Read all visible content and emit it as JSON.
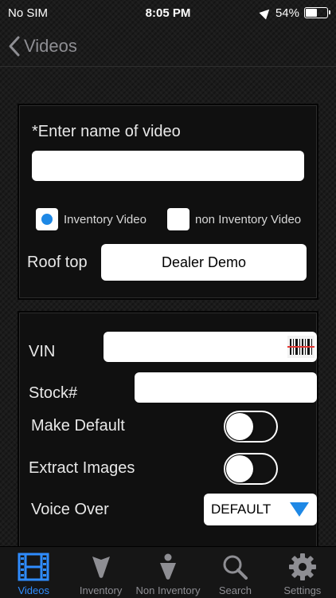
{
  "status_bar": {
    "carrier": "No SIM",
    "time": "8:05 PM",
    "battery": "54%",
    "battery_level": 0.54
  },
  "nav": {
    "back_label": "Videos"
  },
  "form": {
    "video_name_label": "*Enter name of video",
    "video_name_value": "",
    "radio_inventory_label": "Inventory Video",
    "radio_non_inventory_label": "non Inventory Video",
    "selected_radio": "inventory",
    "rooftop_label": "Roof top",
    "rooftop_value": "Dealer Demo",
    "vin_label": "VIN",
    "vin_value": "",
    "stock_label": "Stock#",
    "stock_value": "",
    "make_default_label": "Make Default",
    "make_default_on": false,
    "extract_images_label": "Extract Images",
    "extract_images_on": false,
    "voice_over_label": "Voice Over",
    "voice_over_value": "DEFAULT"
  },
  "tabs": [
    {
      "label": "Videos",
      "icon": "film-icon",
      "active": true
    },
    {
      "label": "Inventory",
      "icon": "inventory-icon",
      "active": false
    },
    {
      "label": "Non Inventory",
      "icon": "person-icon",
      "active": false
    },
    {
      "label": "Search",
      "icon": "search-icon",
      "active": false
    },
    {
      "label": "Settings",
      "icon": "gear-icon",
      "active": false
    }
  ],
  "colors": {
    "accent": "#2f8cff",
    "radio": "#1e88e5"
  }
}
